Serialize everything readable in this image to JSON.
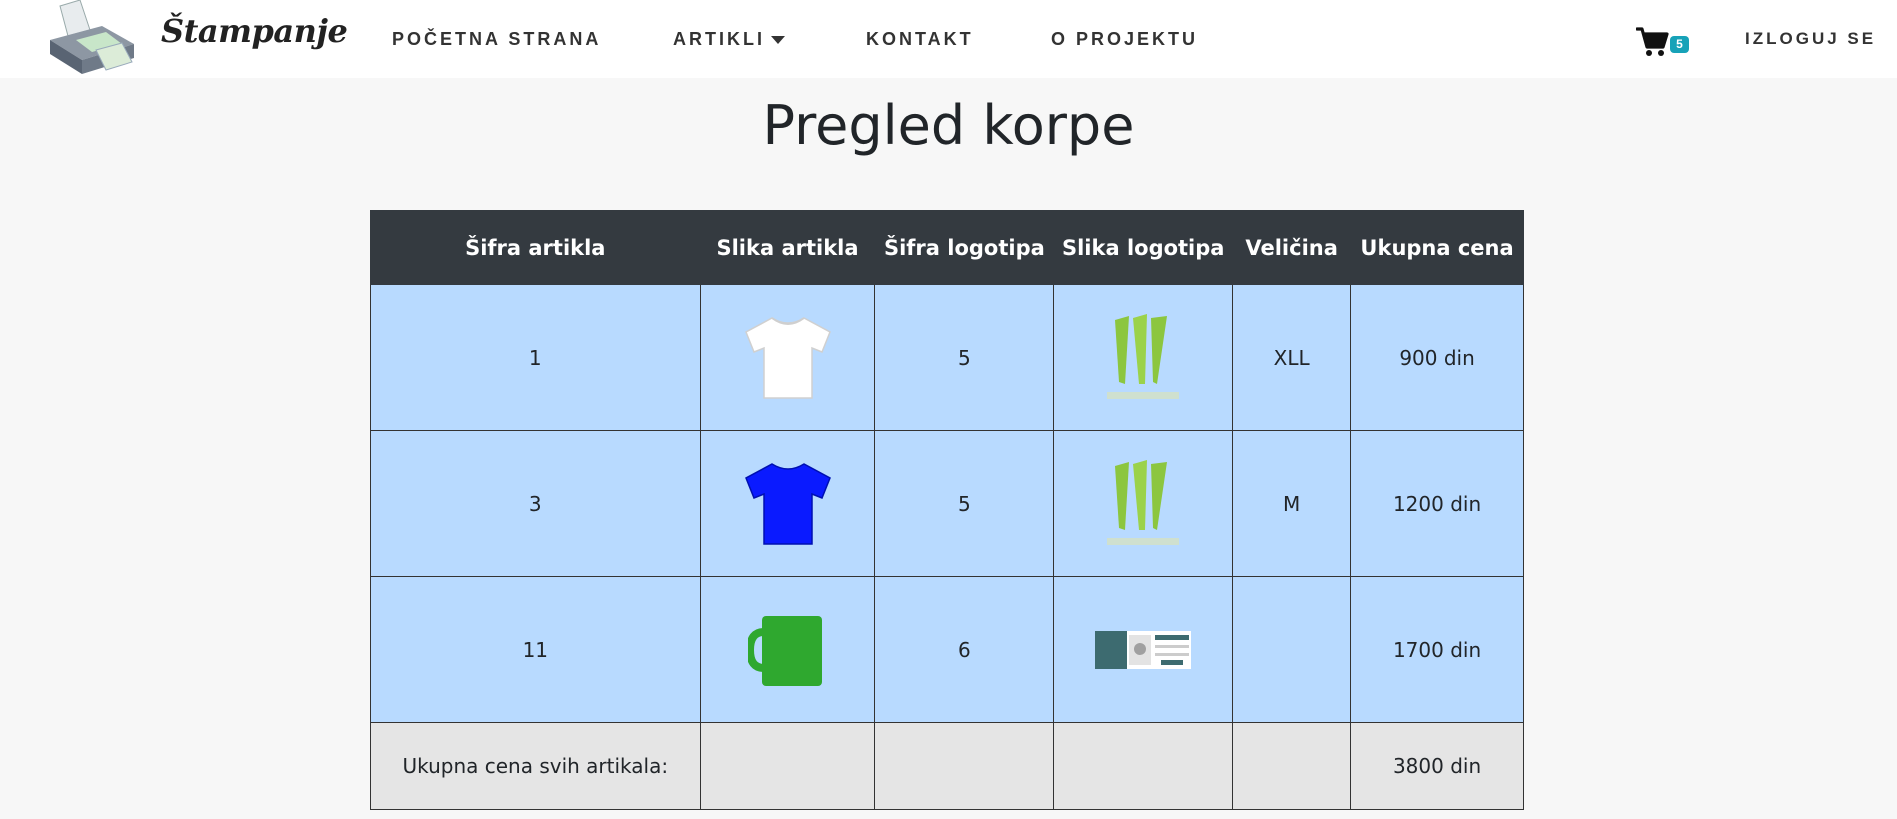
{
  "navbar": {
    "brand": "Štampanje",
    "links": [
      {
        "label": "POČETNA STRANA"
      },
      {
        "label": "ARTIKLI"
      },
      {
        "label": "KONTAKT"
      },
      {
        "label": "O PROJEKTU"
      }
    ],
    "cart_count": "5",
    "logout": "IZLOGUJ SE"
  },
  "page": {
    "title": "Pregled korpe"
  },
  "table": {
    "headers": [
      "Šifra artikla",
      "Slika artikla",
      "Šifra logotipa",
      "Slika logotipa",
      "Veličina",
      "Ukupna cena"
    ],
    "rows": [
      {
        "item_code": "1",
        "item_image": "white-tshirt",
        "logo_code": "5",
        "logo_image": "monster-logo",
        "size": "XLL",
        "price": "900 din"
      },
      {
        "item_code": "3",
        "item_image": "blue-tshirt",
        "logo_code": "5",
        "logo_image": "monster-logo",
        "size": "M",
        "price": "1200 din"
      },
      {
        "item_code": "11",
        "item_image": "green-mug",
        "logo_code": "6",
        "logo_image": "screenshot-logo",
        "size": "",
        "price": "1700 din"
      }
    ],
    "total_label": "Ukupna cena svih artikala:",
    "total_value": "3800 din"
  },
  "colors": {
    "header_bg": "#343a40",
    "row_bg": "#b8daff",
    "total_bg": "#e5e5e5",
    "badge": "#17a2b8",
    "tshirt_blue": "#0a1aff",
    "mug_green": "#2fa82f",
    "monster_green": "#8cc63f"
  }
}
